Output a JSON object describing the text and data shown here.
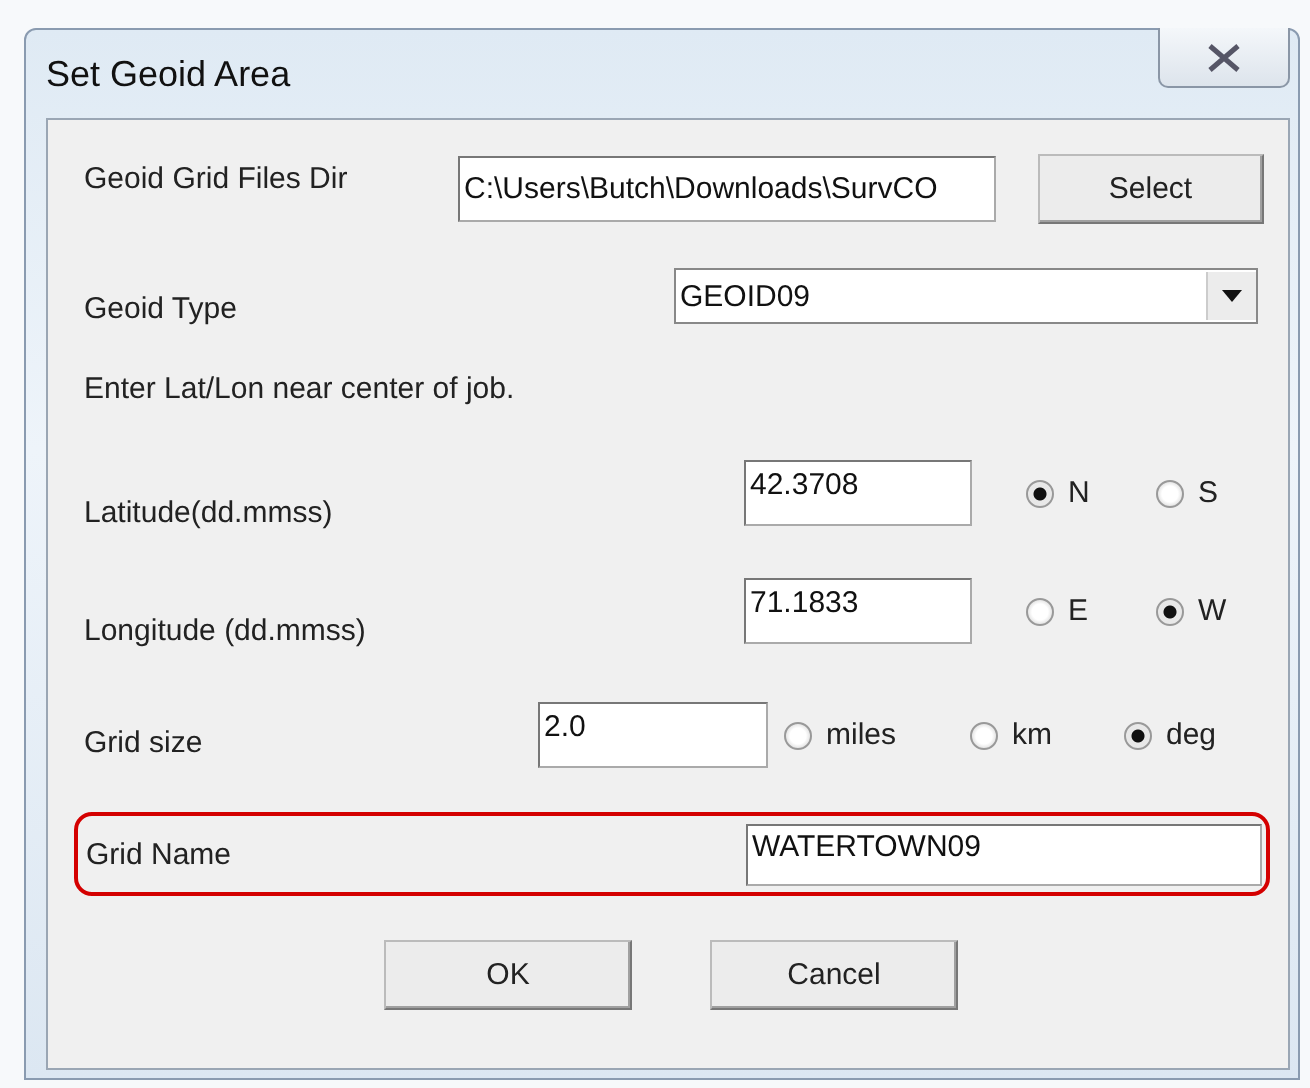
{
  "window": {
    "title": "Set Geoid Area"
  },
  "geoid_dir": {
    "label": "Geoid Grid Files Dir",
    "value": "C:\\Users\\Butch\\Downloads\\SurvCO",
    "button": "Select"
  },
  "geoid_type": {
    "label": "Geoid Type",
    "value": "GEOID09"
  },
  "instruction": "Enter Lat/Lon near center of job.",
  "latitude": {
    "label": "Latitude(dd.mmss)",
    "value": "42.3708",
    "options": [
      {
        "label": "N",
        "selected": true
      },
      {
        "label": "S",
        "selected": false
      }
    ]
  },
  "longitude": {
    "label": "Longitude (dd.mmss)",
    "value": "71.1833",
    "options": [
      {
        "label": "E",
        "selected": false
      },
      {
        "label": "W",
        "selected": true
      }
    ]
  },
  "grid_size": {
    "label": "Grid size",
    "value": "2.0",
    "options": [
      {
        "label": "miles",
        "selected": false
      },
      {
        "label": "km",
        "selected": false
      },
      {
        "label": "deg",
        "selected": true
      }
    ]
  },
  "grid_name": {
    "label": "Grid Name",
    "value": "WATERTOWN09",
    "highlighted": true
  },
  "buttons": [
    "OK",
    "Cancel"
  ]
}
